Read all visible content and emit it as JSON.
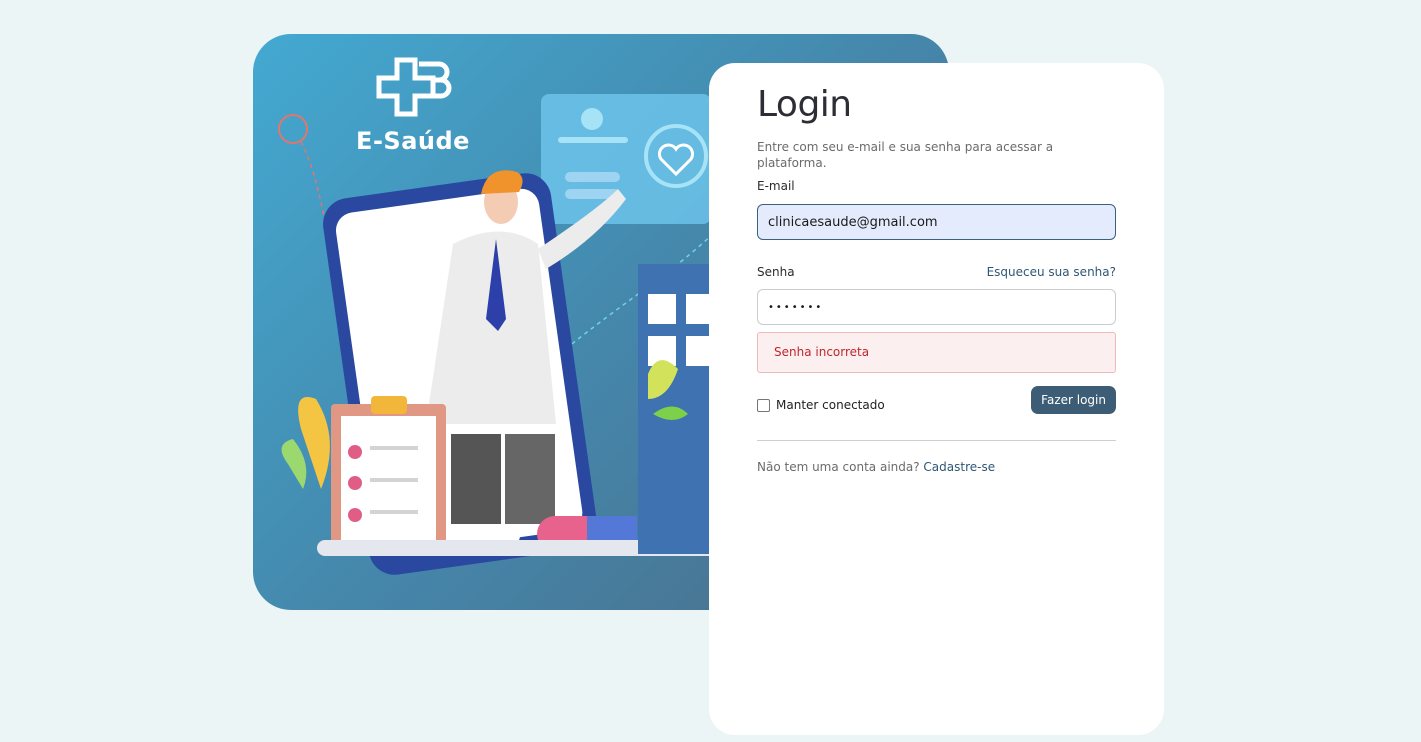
{
  "brand": {
    "name": "E-Saúde"
  },
  "login": {
    "title": "Login",
    "subtitle": "Entre com seu e-mail e sua senha para acessar a plataforma.",
    "email_label": "E-mail",
    "email_value": "clinicaesaude@gmail.com",
    "password_label": "Senha",
    "forgot_link": "Esqueceu sua senha?",
    "password_value": "•••••••",
    "error_message": "Senha incorreta",
    "remember_label": "Manter conectado",
    "remember_checked": false,
    "submit_label": "Fazer login",
    "signup_prompt": "Não tem uma conta ainda?",
    "signup_link": "Cadastre-se"
  },
  "colors": {
    "background": "#ebf5f6",
    "primary_button": "#3d5d76",
    "link": "#2f5674",
    "error_text": "#c0262c",
    "error_bg": "#fcefef",
    "email_bg": "#e3ebfd"
  },
  "icons": [
    "health-cross-logo-icon",
    "heart-pulse-icon",
    "check-icon"
  ]
}
